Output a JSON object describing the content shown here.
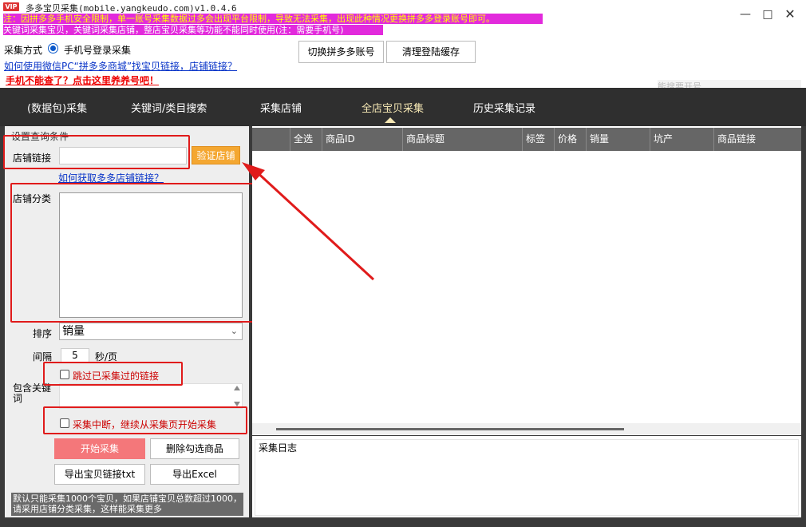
{
  "window": {
    "logo": "VIP",
    "title": "多多宝贝采集(mobile.yangkeudo.com)v1.0.4.6",
    "notice1": "注：因拼多多手机安全限制，单一账号采集数据过多会出现平台限制，导致无法采集，出现此种情况更换拼多多登录账号即可。",
    "notice2": "关键词采集宝贝，关键词采集店铺，整店宝贝采集等功能不能同时使用(注：需要手机号)"
  },
  "topbar": {
    "mode_label": "采集方式",
    "mode_value": "手机号登录采集",
    "switch_account": "切换拼多多账号",
    "clear_cache": "清理登陆缓存",
    "help_link": "如何使用微信PC“拼多多商城”找宝贝链接，店铺链接？",
    "warn_link": "手机不能查了？点击这里养养号吧！",
    "search_ghost": "能搜要开号"
  },
  "tabs": [
    {
      "label": "(数据包)采集"
    },
    {
      "label": "关键词/类目搜索"
    },
    {
      "label": "采集店铺"
    },
    {
      "label": "全店宝贝采集"
    },
    {
      "label": "历史采集记录"
    }
  ],
  "query": {
    "section_title": "设置查询条件",
    "shop_link_label": "店铺链接",
    "shop_link_value": "",
    "verify_button": "验证店铺",
    "shop_help": "如何获取多多店铺链接？",
    "category_label": "店铺分类",
    "sort_label": "排序",
    "sort_value": "销量",
    "interval_label": "间隔",
    "interval_value": "5",
    "interval_unit": "秒/页",
    "skip_collected": "跳过已采集过的链接",
    "keyword_label": "包含关键词",
    "resume_label": "采集中断，继续从采集页开始采集",
    "start_button": "开始采集",
    "delete_button": "删除勾选商品",
    "export_txt": "导出宝贝链接txt",
    "export_excel": "导出Excel",
    "footer_note": "默认只能采集1000个宝贝，如果店铺宝贝总数超过1000，请采用店铺分类采集，这样能采集更多"
  },
  "table": {
    "columns": [
      "全选",
      "商品ID",
      "商品标题",
      "标签",
      "价格",
      "销量",
      "坑产",
      "商品链接"
    ]
  },
  "log": {
    "label": "采集日志"
  }
}
